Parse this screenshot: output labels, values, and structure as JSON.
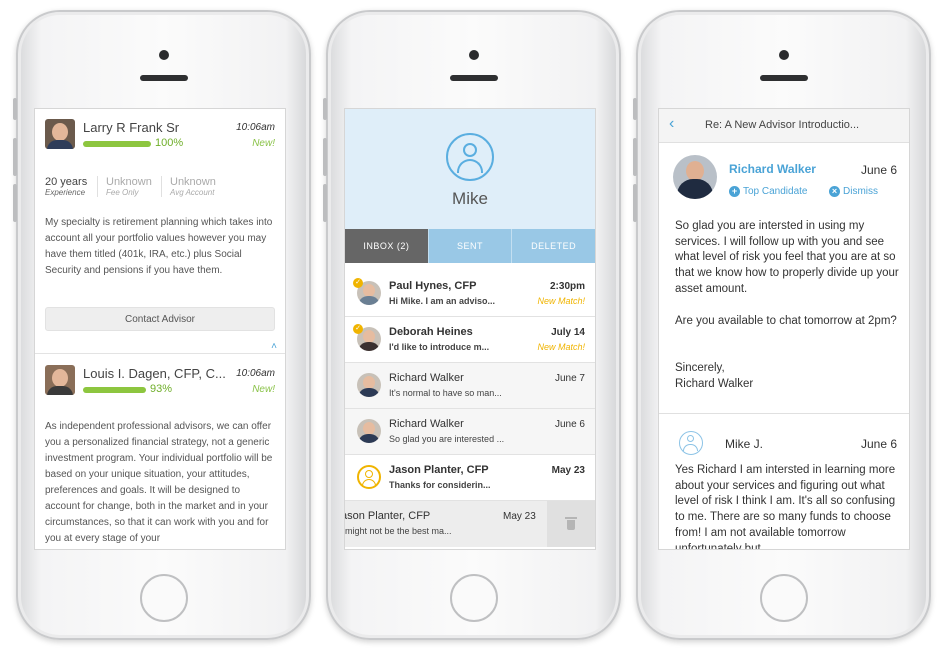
{
  "advisor_list": {
    "cards": [
      {
        "name": "Larry R Frank Sr",
        "time": "10:06am",
        "badge": "New!",
        "match": "100%",
        "match_fraction": 1.0,
        "stats": [
          {
            "value": "20 years",
            "label": "Experience"
          },
          {
            "value": "Unknown",
            "label": "Fee Only"
          },
          {
            "value": "Unknown",
            "label": "Avg Account"
          }
        ],
        "description": "My specialty is retirement planning which takes into account all your portfolio values however you may have them titled (401k, IRA, etc.) plus Social Security and pensions if you have them.",
        "contact_label": "Contact Advisor"
      },
      {
        "name": "Louis I. Dagen, CFP, C...",
        "time": "10:06am",
        "badge": "New!",
        "match": "93%",
        "match_fraction": 0.93,
        "description": "As independent professional advisors, we can offer you a personalized financial strategy, not a generic investment program. Your individual portfolio will be based on your unique situation, your attitudes, preferences and goals. It will be designed to account for change, both in the market and in your circumstances, so that it can work with you and for you at every stage of your"
      }
    ]
  },
  "inbox": {
    "user_name": "Mike",
    "tabs": [
      "INBOX (2)",
      "SENT",
      "DELETED"
    ],
    "messages": [
      {
        "name": "Paul Hynes, CFP",
        "preview": "Hi Mike. I am an adviso...",
        "date": "2:30pm",
        "tag": "New Match!"
      },
      {
        "name": "Deborah Heines",
        "preview": "I'd like to introduce m...",
        "date": "July 14",
        "tag": "New Match!"
      },
      {
        "name": "Richard Walker",
        "preview": "It's normal to have so man...",
        "date": "June 7"
      },
      {
        "name": "Richard Walker",
        "preview": "So glad you are interested ...",
        "date": "June 6"
      },
      {
        "name": "Jason Planter, CFP",
        "preview": "Thanks for considerin...",
        "date": "May 23"
      }
    ],
    "swiped_message": {
      "name": "ason Planter, CFP",
      "preview": "might not be the best ma...",
      "date": "May 23"
    }
  },
  "thread": {
    "title": "Re: A New Advisor Introductio...",
    "sender": {
      "name": "Richard Walker",
      "date": "June 6"
    },
    "actions": {
      "top_candidate": "Top Candidate",
      "dismiss": "Dismiss"
    },
    "body_paragraphs": [
      "So glad you are intersted in using my services. I will follow up with you and see what level of risk you feel that you are at so that we know how to properly divide up your asset amount.",
      "Are you available to chat tomorrow at 2pm?",
      "Sincerely,\nRichard Walker"
    ],
    "reply": {
      "name": "Mike J.",
      "date": "June 6",
      "body": "Yes Richard I am intersted in learning more about your services and figuring out what level of risk I think I am. It's all so confusing to me.  There are so many funds to choose from! I am not available tomorrow unfortunately but"
    }
  }
}
